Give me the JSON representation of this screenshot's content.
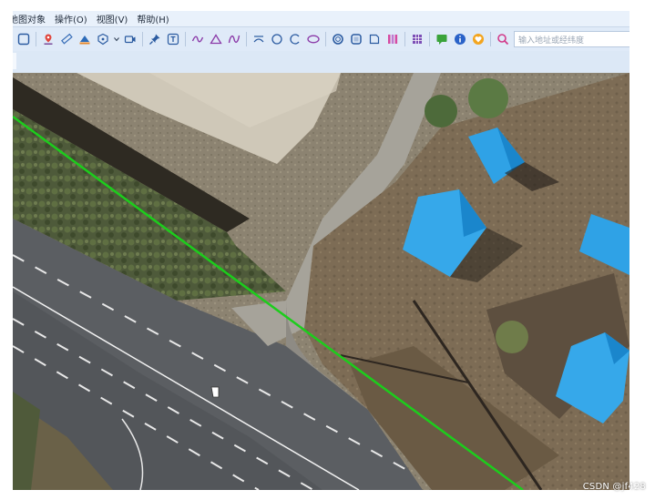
{
  "menu": {
    "items": [
      {
        "label": "地图对象"
      },
      {
        "label": "操作(O)"
      },
      {
        "label": "视图(V)"
      },
      {
        "label": "帮助(H)"
      }
    ]
  },
  "toolbar": {
    "search_placeholder": "输入地址或经纬度",
    "icons": [
      "square-outline-icon",
      "location-pin-icon",
      "ruler-icon",
      "measure-area-icon",
      "polygon-shield-icon",
      "video-icon",
      "pin-icon",
      "text-icon",
      "polyline-icon",
      "triangle-icon",
      "curve-icon",
      "arc-icon",
      "circle-icon",
      "circle-arc-icon",
      "ellipse-icon",
      "ring-icon",
      "square-rounded-icon",
      "layer-icon",
      "bars-icon",
      "grid-icon",
      "comment-icon",
      "info-icon",
      "heart-shield-icon",
      "search-icon"
    ]
  },
  "colors": {
    "grass_line": "#1ccd1c",
    "roof_blue": "#2fa2e6",
    "road": "#5c5f63"
  },
  "watermark": "CSDN @jf428"
}
